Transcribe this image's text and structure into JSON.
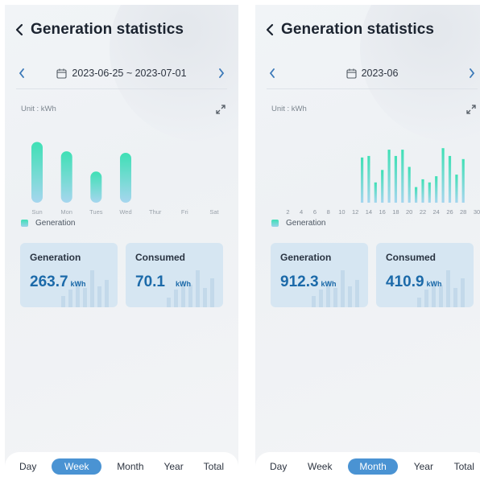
{
  "screens": [
    {
      "header": {
        "title": "Generation statistics"
      },
      "date_range": "2023-06-25 ~ 2023-07-01",
      "unit_label": "Unit : kWh",
      "legend": "Generation",
      "cards": [
        {
          "label": "Generation",
          "value": "263.7",
          "unit": "kWh"
        },
        {
          "label": "Consumed",
          "value": "70.1",
          "unit": "kWh"
        }
      ],
      "tabs": [
        "Day",
        "Week",
        "Month",
        "Year",
        "Total"
      ],
      "active_tab": "Week"
    },
    {
      "header": {
        "title": "Generation statistics"
      },
      "date_range": "2023-06",
      "unit_label": "Unit : kWh",
      "legend": "Generation",
      "cards": [
        {
          "label": "Generation",
          "value": "912.3",
          "unit": "kWh"
        },
        {
          "label": "Consumed",
          "value": "410.9",
          "unit": "kWh"
        }
      ],
      "tabs": [
        "Day",
        "Week",
        "Month",
        "Year",
        "Total"
      ],
      "active_tab": "Month"
    }
  ],
  "colors": {
    "accent": "#4a93d3",
    "bar_top": "#3fe0b5",
    "bar_bottom": "#a6d6ee",
    "card_bg": "#d6e6f2",
    "value_text": "#1c6aa9"
  },
  "chart_data": [
    {
      "type": "bar",
      "categories": [
        "Sun",
        "Mon",
        "Tues",
        "Wed",
        "Thur",
        "Fri",
        "Sat"
      ],
      "series": [
        {
          "name": "Generation",
          "values": [
            78,
            66,
            40,
            64,
            0,
            0,
            0
          ]
        }
      ],
      "ylim": [
        0,
        95
      ],
      "grid": false,
      "legend_position": "bottom-left"
    },
    {
      "type": "bar",
      "categories": [
        "1",
        "2",
        "3",
        "4",
        "5",
        "6",
        "7",
        "8",
        "9",
        "10",
        "11",
        "12",
        "13",
        "14",
        "15",
        "16",
        "17",
        "18",
        "19",
        "20",
        "21",
        "22",
        "23",
        "24",
        "25",
        "26",
        "27",
        "28",
        "29",
        "30"
      ],
      "tick_labels": [
        "2",
        "4",
        "6",
        "8",
        "10",
        "12",
        "14",
        "16",
        "18",
        "20",
        "22",
        "24",
        "26",
        "28",
        "30"
      ],
      "series": [
        {
          "name": "Generation",
          "values": [
            0,
            0,
            0,
            0,
            0,
            0,
            0,
            0,
            0,
            0,
            0,
            0,
            58,
            60,
            26,
            42,
            68,
            60,
            68,
            46,
            20,
            30,
            26,
            34,
            70,
            60,
            36,
            56,
            0,
            0
          ]
        }
      ],
      "ylim": [
        0,
        95
      ],
      "grid": false,
      "legend_position": "bottom-left"
    }
  ]
}
